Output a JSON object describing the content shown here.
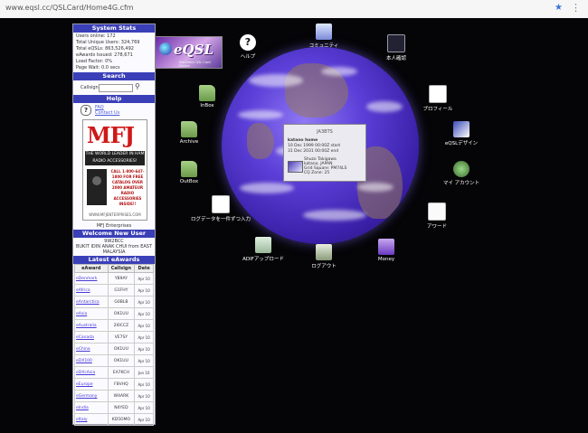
{
  "browser": {
    "url": "www.eqsl.cc/QSLCard/Home4G.cfm",
    "star_icon": "star-icon",
    "menu_icon": "menu-icon"
  },
  "sidebar": {
    "stats_title": "System Stats",
    "stats": [
      "Users online: 172",
      "Total Unique Users: 324,769",
      "Total eQSLs: 863,526,492",
      "eAwards Issued: 278,671",
      "Load Factor: 0%",
      "Page Wait: 0.0 secs"
    ],
    "search_title": "Search",
    "callsign_label": "Callsign:",
    "help_title": "Help",
    "faq_label": "FAQ",
    "contact_label": "Contact Us",
    "ad": {
      "logo": "MFJ",
      "tagline": "THE WORLD LEADER IN HAM RADIO ACCESSORIES!",
      "promo": "CALL 1-800-647-1800 FOR FREE CATALOG OVER 2000 AMATEUR RADIO ACCESSORIES INSIDE!!",
      "site": "WWW.MFJENTERPRISES.COM",
      "caption": "MFJ Enterprises"
    },
    "welcome_title": "Welcome New User",
    "welcome_user": "9W2BCC",
    "welcome_location": "BUKIT IDIN ANAK CHUI from EAST MALAYSIA",
    "awards_title": "Latest eAwards",
    "awards_columns": [
      "eAward",
      "Callsign",
      "Date"
    ],
    "awards": [
      {
        "award": "eDenmark",
        "callsign": "YB9AY",
        "date": "Apr 10"
      },
      {
        "award": "eAfrica",
        "callsign": "G1FHY",
        "date": "Apr 10"
      },
      {
        "award": "eAntarctica",
        "callsign": "G0BLB",
        "date": "Apr 10"
      },
      {
        "award": "eAsia",
        "callsign": "OK1UU",
        "date": "Apr 10"
      },
      {
        "award": "eAustralia",
        "callsign": "2I0CCZ",
        "date": "Apr 10"
      },
      {
        "award": "eCanada",
        "callsign": "VE7SY",
        "date": "Apr 10"
      },
      {
        "award": "eChina",
        "callsign": "OK1UU",
        "date": "Apr 10"
      },
      {
        "award": "eDX100",
        "callsign": "OK1UU",
        "date": "Apr 10"
      },
      {
        "award": "eDXcAsia",
        "callsign": "EA7KCH",
        "date": "Jun 10"
      },
      {
        "award": "eEurope",
        "callsign": "F8VHQ",
        "date": "Apr 10"
      },
      {
        "award": "eGermany",
        "callsign": "W4ARK",
        "date": "Apr 10"
      },
      {
        "award": "eIndia",
        "callsign": "N4YED",
        "date": "Apr 10"
      },
      {
        "award": "eItaly",
        "callsign": "KD5OMO",
        "date": "Apr 10"
      }
    ]
  },
  "logo": {
    "text": "eQSL",
    "subtitle": "Electronic QSL Card Centre"
  },
  "popup": {
    "callsign": "JA3BTS",
    "nickname": "katano home",
    "start": "10 Dec 1999 00:00Z start",
    "end": "31 Dec 2031 00:00Z end",
    "name": "Shuzo Takigawa",
    "city": "katano, JAPAN",
    "grid": "Grid Square: PM74LS",
    "cq_zone": "CQ Zone: 25"
  },
  "menu": {
    "help": "ヘルプ",
    "community": "コミュニティ",
    "self": "本人確認",
    "profile": "プロフィール",
    "design": "eQSLデザイン",
    "account": "マイ アカウント",
    "award": "アワード",
    "money": "Money",
    "logout": "ログアウト",
    "adif": "ADIFアップロード",
    "entry": "ログデータを一件ずつ入力",
    "outbox": "OutBox",
    "archive": "Archive",
    "inbox": "InBox"
  }
}
